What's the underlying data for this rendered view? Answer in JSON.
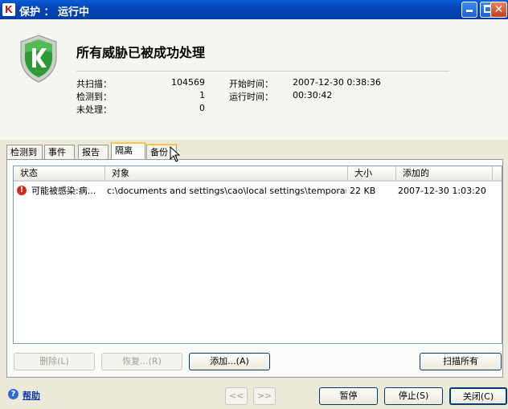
{
  "window": {
    "title": "保护 ： 运行中",
    "logo_letter": "K"
  },
  "header": {
    "headline": "所有威胁已被成功处理",
    "stats": {
      "scanned_label": "共扫描：",
      "scanned_value": "104569",
      "detected_label": "检测到：",
      "detected_value": "1",
      "unhandled_label": "未处理：",
      "unhandled_value": "0",
      "start_label": "开始时间：",
      "start_value": "2007-12-30 0:38:36",
      "runtime_label": "运行时间：",
      "runtime_value": "00:30:42"
    }
  },
  "tabs": [
    "检测到",
    "事件",
    "报告",
    "隔离",
    "备份"
  ],
  "active_tab": "隔离",
  "table": {
    "columns": [
      "状态",
      "对象",
      "大小",
      "添加的"
    ],
    "rows": [
      {
        "status": "可能被感染:病...",
        "object": "c:\\documents and settings\\cao\\local settings\\temporary int...",
        "size": "22 KB",
        "added": "2007-12-30 1:03:20"
      }
    ]
  },
  "buttons": {
    "delete": "删除(L)",
    "restore": "恢复...(R)",
    "add": "添加...(A)",
    "scan_all": "扫描所有",
    "prev": "<<",
    "next": ">>",
    "pause": "暂停",
    "stop": "停止(S)",
    "close": "关闭(C)"
  },
  "help": "帮助",
  "colors": {
    "titlebar": "#0745b8",
    "accent_tab": "#ffc83c",
    "shield_green": "#2f9a35",
    "warning_red": "#d42a1a"
  }
}
